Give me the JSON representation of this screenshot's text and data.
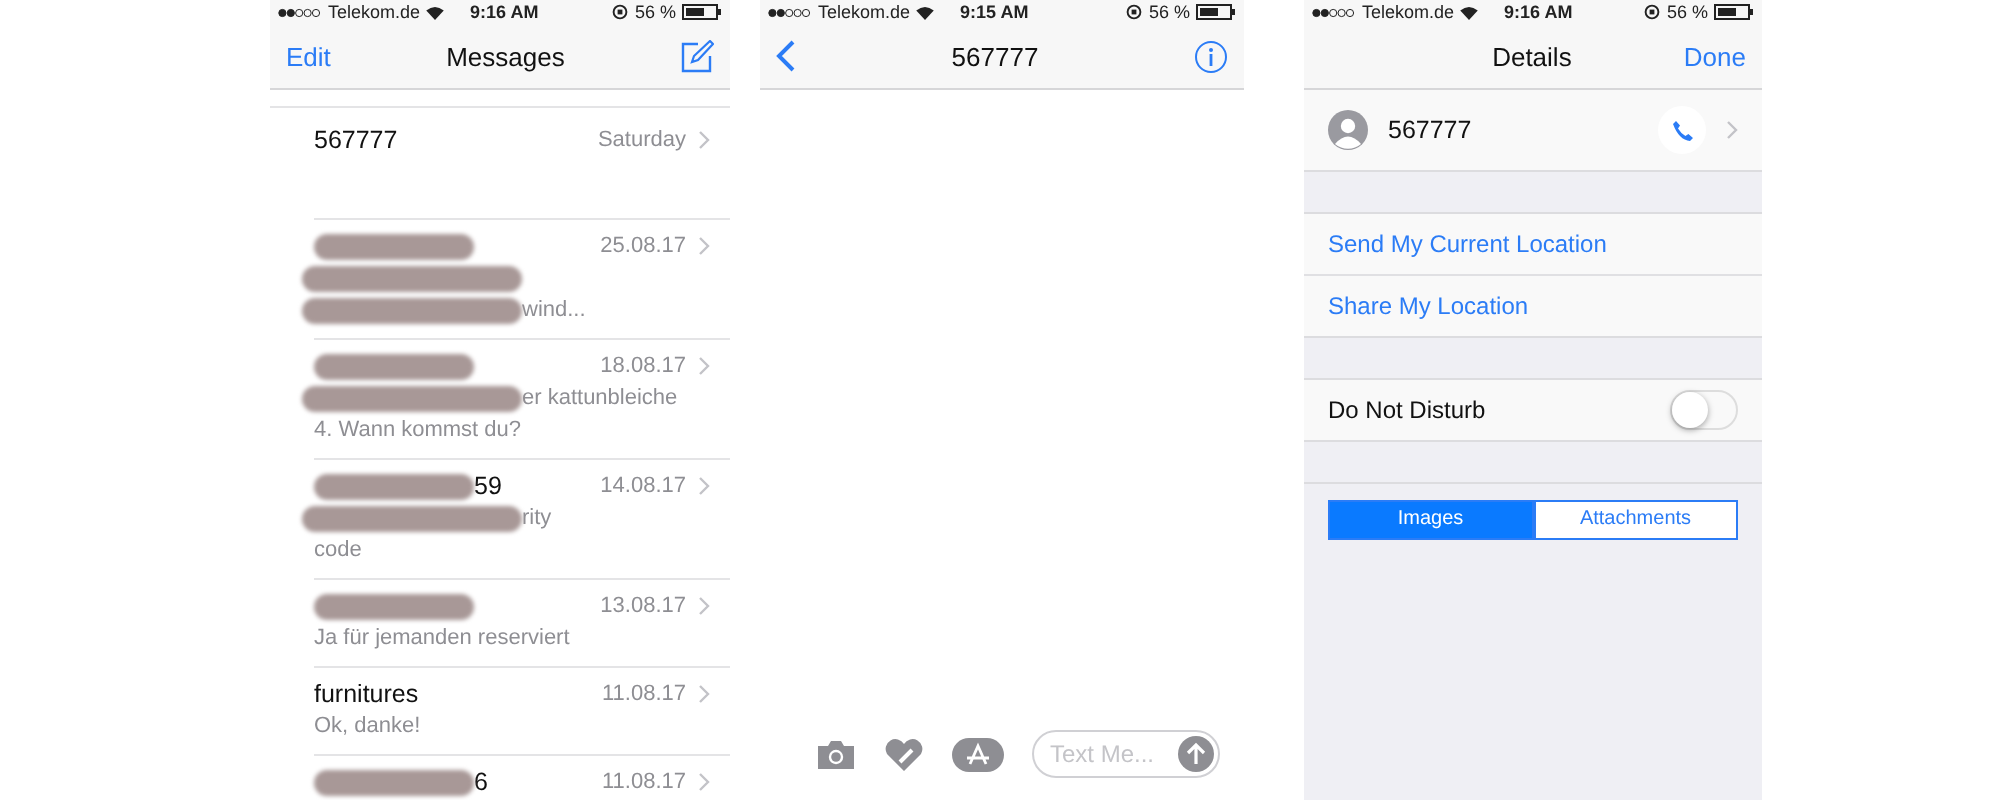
{
  "screens": [
    {
      "kind": "list",
      "status": {
        "carrier": "Telekom.de",
        "time": "9:16 AM",
        "battery": "56 %"
      },
      "nav": {
        "left": "Edit",
        "title": "Messages"
      },
      "rows": [
        {
          "title": "567777",
          "title_redacted": false,
          "date": "Saturday",
          "preview": []
        },
        {
          "title_redacted": true,
          "date": "25.08.17",
          "preview": [
            {
              "redacted": true
            },
            {
              "redacted": true,
              "text": "wind..."
            }
          ]
        },
        {
          "title_redacted": true,
          "date": "18.08.17",
          "preview": [
            {
              "redacted": true,
              "text": "er kattunbleiche"
            },
            {
              "redacted": false,
              "text": "4. Wann kommst du?"
            }
          ]
        },
        {
          "title": "59",
          "title_redacted": true,
          "date": "14.08.17",
          "preview": [
            {
              "redacted": true,
              "text": "rity"
            },
            {
              "redacted": false,
              "text": "code"
            }
          ]
        },
        {
          "title_redacted": true,
          "date": "13.08.17",
          "preview": [
            {
              "redacted": false,
              "text": "Ja für jemanden reserviert"
            }
          ]
        },
        {
          "title": "furnitures",
          "title_redacted": false,
          "date": "11.08.17",
          "preview": [
            {
              "redacted": false,
              "text": "Ok, danke!"
            }
          ]
        },
        {
          "title": "6",
          "title_redacted": true,
          "date": "11.08.17",
          "preview": []
        }
      ]
    },
    {
      "kind": "chat",
      "status": {
        "carrier": "Telekom.de",
        "time": "9:15 AM",
        "battery": "56 %"
      },
      "nav": {
        "title": "567777"
      },
      "composer": {
        "placeholder": "Text Me..."
      }
    },
    {
      "kind": "details",
      "status": {
        "carrier": "Telekom.de",
        "time": "9:16 AM",
        "battery": "56 %"
      },
      "nav": {
        "title": "Details",
        "right": "Done"
      },
      "contact": {
        "name": "567777"
      },
      "actions": [
        "Send My Current Location",
        "Share My Location"
      ],
      "toggle": {
        "label": "Do Not Disturb",
        "on": false
      },
      "segments": [
        {
          "label": "Images",
          "selected": true
        },
        {
          "label": "Attachments",
          "selected": false
        }
      ]
    }
  ]
}
